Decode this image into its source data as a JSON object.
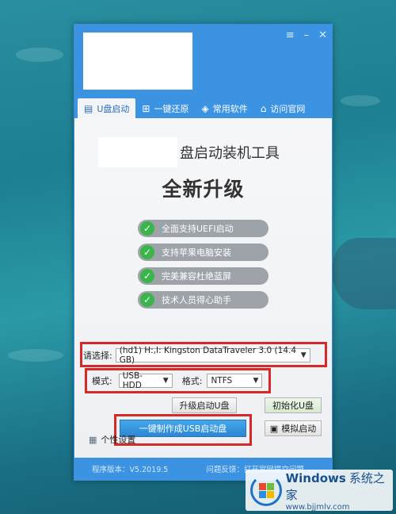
{
  "window": {
    "controls": [
      "≡",
      "–",
      "✕"
    ],
    "tabs": [
      {
        "label": "U盘启动",
        "icon": "usb-icon"
      },
      {
        "label": "一键还原",
        "icon": "windows-icon"
      },
      {
        "label": "常用软件",
        "icon": "box-icon"
      },
      {
        "label": "访问官网",
        "icon": "home-icon"
      }
    ]
  },
  "content": {
    "heading": "盘启动装机工具",
    "subheading": "全新升级",
    "features": [
      "全面支持UEFI启动",
      "支持苹果电脑安装",
      "完美兼容杜绝蓝屏",
      "技术人员得心助手"
    ],
    "device_label": "请选择:",
    "device_value": "(hd1) H:,I: Kingston DataTraveler 3.0 (14.4 GB)",
    "mode_label": "模式:",
    "mode_value": "USB-HDD",
    "format_label": "格式:",
    "format_value": "NTFS",
    "upgrade_button": "升级启动U盘",
    "init_button": "初始化U盘",
    "make_button": "一键制作成USB启动盘",
    "simulate_button": "模拟启动",
    "settings_label": "个性设置"
  },
  "status": {
    "version": "程序版本：V5.2019.5",
    "extra": "问题反馈：打开官网提交问题"
  },
  "brand": {
    "name": "Windows",
    "name_cn": "系统之家",
    "url": "www.bjjmlv.com"
  },
  "colors": {
    "titlebar": "#3b93e2",
    "check": "#39b54a",
    "highlight_frame": "#d62a2a",
    "primary_button": "#2b87d3"
  }
}
